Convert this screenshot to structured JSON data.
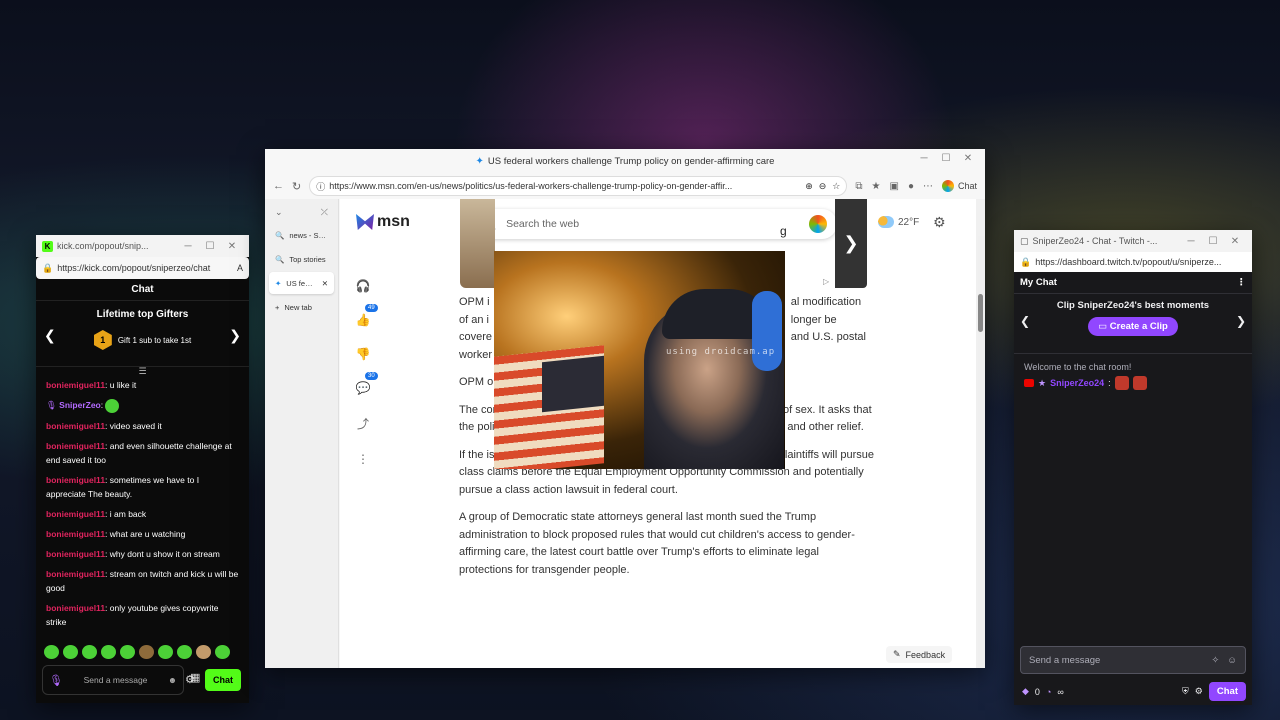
{
  "kick": {
    "window_title": "kick.com/popout/snip...",
    "url": "https://kick.com/popout/sniperzeo/chat",
    "reader_icon": "A",
    "header": "Chat",
    "gifters_title": "Lifetime top Gifters",
    "gift_rank": "1",
    "gift_text": "Gift 1 sub to take 1st",
    "messages": [
      {
        "user": "boniemiguel11",
        "text": ": u like it"
      },
      {
        "user": "SniperZeo",
        "text": ":"
      },
      {
        "user": "boniemiguel11",
        "text": ": video saved it"
      },
      {
        "user": "boniemiguel11",
        "text": ": and even silhouette challenge at end saved it too"
      },
      {
        "user": "boniemiguel11",
        "text": ": sometimes we have to I appreciate The beauty."
      },
      {
        "user": "boniemiguel11",
        "text": ": i am back"
      },
      {
        "user": "boniemiguel11",
        "text": ": what are u watching"
      },
      {
        "user": "boniemiguel11",
        "text": ": why dont u show it on stream"
      },
      {
        "user": "boniemiguel11",
        "text": ": stream on twitch and kick u will be good"
      },
      {
        "user": "boniemiguel11",
        "text": ": only youtube gives copywrite strike"
      }
    ],
    "input_placeholder": "Send a message",
    "chat_button": "Chat"
  },
  "edge": {
    "window_title": "US federal workers challenge Trump policy on gender-affirming care",
    "url": "https://www.msn.com/en-us/news/politics/us-federal-workers-challenge-trump-policy-on-gender-affir...",
    "copilot_label": "Chat",
    "tabs": [
      {
        "label": "news - Sea..."
      },
      {
        "label": "Top stories"
      },
      {
        "label": "US fede..."
      },
      {
        "label": "New tab"
      }
    ],
    "logo": "msn",
    "search_placeholder": "Search the web",
    "weather": "22°F",
    "rail_counts": {
      "likes": "49",
      "comments": "30"
    },
    "webcam_overlay": "using droidcam.ap",
    "article": {
      "p1_visible": [
        "OPM i",
        "of an i",
        "covere",
        "worker"
      ],
      "p1_right": [
        "al modification",
        "longer be",
        "and U.S. postal"
      ],
      "p2": "OPM o",
      "p3": "The complaint argues that the policy is discriminatory on the basis of sex. It asks that the policy be rescinded and seeks payment for economic damages and other relief.",
      "p4": "If the issue is not resolved with the OPM, the foundation said that plaintiffs will pursue class claims before the Equal Employment Opportunity Commission and potentially pursue a class action lawsuit in federal court.",
      "p5": "A group of Democratic state attorneys general last month sued the Trump administration to block proposed rules that would cut children's access to gender-affirming care, the latest court battle over Trump's efforts to eliminate legal protections for transgender people."
    },
    "carousel_text": "g",
    "feedback": "Feedback"
  },
  "twitch": {
    "window_title": "SniperZeo24 - Chat - Twitch -...",
    "url": "https://dashboard.twitch.tv/popout/u/sniperze...",
    "header": "My Chat",
    "clip_title": "Clip SniperZeo24's best moments",
    "clip_button": "Create a Clip",
    "welcome": "Welcome to the chat room!",
    "message_user": "SniperZeo24",
    "message_sep": ":",
    "input_placeholder": "Send a message",
    "points": "0",
    "infinity": "∞",
    "chat_button": "Chat"
  }
}
